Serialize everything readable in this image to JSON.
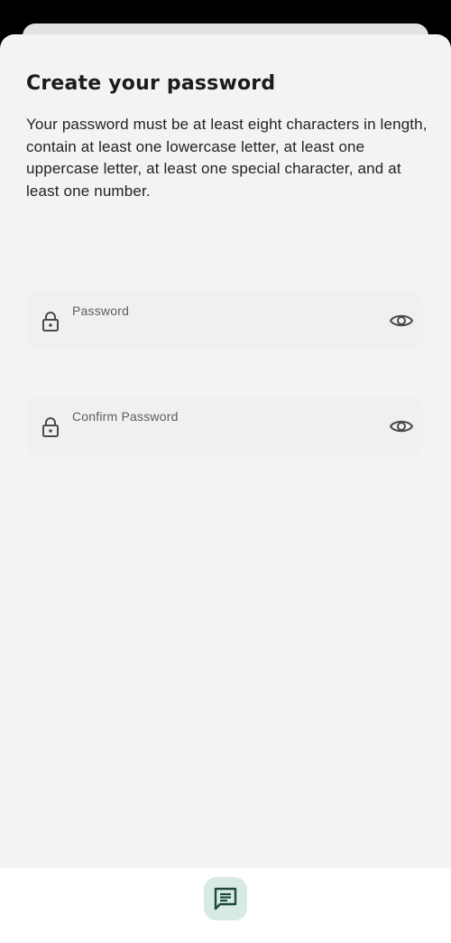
{
  "page": {
    "title": "Create your password",
    "description": "Your password must be at least eight characters in length, contain at least one lowercase letter, at least one uppercase letter, at least one special character, and at least one number."
  },
  "fields": [
    {
      "label": "Password",
      "value": "",
      "leading_icon": "lock-icon",
      "trailing_icon": "eye-icon"
    },
    {
      "label": "Confirm Password",
      "value": "",
      "leading_icon": "lock-icon",
      "trailing_icon": "eye-icon"
    }
  ],
  "bottom_bar": {
    "action_icon": "chat-icon"
  },
  "colors": {
    "sheet_background": "#f3f3f3",
    "field_background": "#f0f0f0",
    "chat_button_background": "#d7eae4",
    "chat_icon": "#1e4a3d"
  }
}
